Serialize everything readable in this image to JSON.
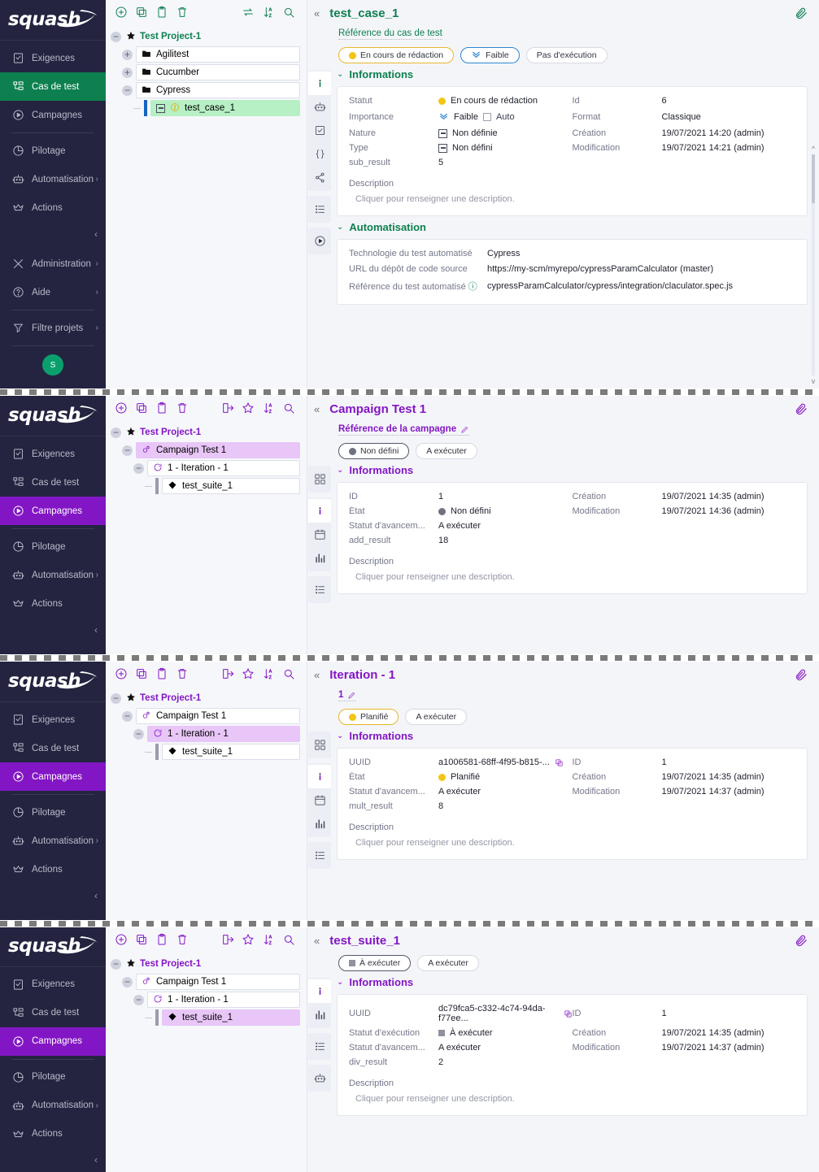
{
  "brand": {
    "logo_text": "squash",
    "avatar_initial": "S"
  },
  "sidebar": {
    "items": [
      {
        "label": "Exigences",
        "icon": "requirements-icon"
      },
      {
        "label": "Cas de test",
        "icon": "test-case-icon"
      },
      {
        "label": "Campagnes",
        "icon": "campaign-icon"
      },
      {
        "label": "Pilotage",
        "icon": "dashboard-icon"
      },
      {
        "label": "Automatisation",
        "icon": "robot-icon"
      },
      {
        "label": "Actions",
        "icon": "crown-icon"
      },
      {
        "label": "Administration",
        "icon": "tools-icon"
      },
      {
        "label": "Aide",
        "icon": "help-icon"
      },
      {
        "label": "Filtre projets",
        "icon": "filter-icon"
      }
    ]
  },
  "panels": [
    {
      "accent": "#0e8050",
      "active_nav": "Cas de test",
      "toolbar": [
        "add-icon",
        "copy-icon",
        "paste-icon",
        "delete-icon",
        "transfer-icon",
        "sort-icon",
        "search-icon"
      ],
      "tree": {
        "root": "Test Project-1",
        "nodes": [
          {
            "label": "Agilitest",
            "icon": "folder-icon",
            "depth": 1,
            "selected": false
          },
          {
            "label": "Cucumber",
            "icon": "folder-icon",
            "depth": 1,
            "selected": false
          },
          {
            "label": "Cypress",
            "icon": "folder-icon",
            "depth": 1,
            "selected": false
          },
          {
            "label": "test_case_1",
            "icon": "test-case-icon",
            "depth": 2,
            "selected": true
          }
        ]
      },
      "title": "test_case_1",
      "reference": "Référence du cas de test",
      "pills": [
        {
          "label": "En cours de rédaction",
          "style": "yellow",
          "marker": "dot-yellow"
        },
        {
          "label": "Faible",
          "style": "blue",
          "marker": "chevrons-down"
        },
        {
          "label": "Pas d'exécution",
          "style": "plain",
          "marker": "none"
        }
      ],
      "rail": [
        "info-icon",
        "robot-icon",
        "checkbox-icon",
        "braces-icon",
        "share-icon",
        "list-icon",
        "play-icon"
      ],
      "sections": [
        {
          "title": "Informations",
          "rows_left": [
            {
              "k": "Statut",
              "v": "En cours de rédaction",
              "marker": "dot-yellow"
            },
            {
              "k": "Importance",
              "v": "Faible",
              "marker": "chevrons-down",
              "extra": "Auto",
              "extra_type": "checkbox"
            },
            {
              "k": "Nature",
              "v": "Non définie",
              "marker": "square-minus"
            },
            {
              "k": "Type",
              "v": "Non défini",
              "marker": "square-minus"
            },
            {
              "k": "sub_result",
              "v": "5",
              "marker": "none"
            }
          ],
          "rows_right": [
            {
              "k": "Id",
              "v": "6"
            },
            {
              "k": "Format",
              "v": "Classique"
            },
            {
              "k": "Création",
              "v": "19/07/2021 14:20 (admin)"
            },
            {
              "k": "Modification",
              "v": "19/07/2021 14:21 (admin)"
            }
          ],
          "description_label": "Description",
          "description_value": "Cliquer pour renseigner une description."
        },
        {
          "title": "Automatisation",
          "auto_rows": [
            {
              "k": "Technologie du test automatisé",
              "v": "Cypress"
            },
            {
              "k": "URL du dépôt de code source",
              "v": "https://my-scm/myrepo/cypressParamCalculator (master)"
            },
            {
              "k": "Référence du test automatisé",
              "v": "cypressParamCalculator/cypress/integration/claculator.spec.js",
              "help": true
            }
          ]
        }
      ]
    },
    {
      "accent": "#8316c4",
      "active_nav": "Campagnes",
      "toolbar": [
        "add-icon",
        "copy-icon",
        "paste-icon",
        "delete-icon",
        "export-icon",
        "star-icon",
        "sort-icon",
        "search-icon"
      ],
      "tree": {
        "root": "Test Project-1",
        "nodes": [
          {
            "label": "Campaign Test 1",
            "icon": "campaign-node-icon",
            "depth": 1,
            "selected": true
          },
          {
            "label": "1 - Iteration - 1",
            "icon": "iteration-icon",
            "depth": 2,
            "selected": false
          },
          {
            "label": "test_suite_1",
            "icon": "suite-icon",
            "depth": 3,
            "selected": false
          }
        ]
      },
      "title": "Campaign Test 1",
      "reference": "Référence de la campagne",
      "pills": [
        {
          "label": "Non défini",
          "style": "dark",
          "marker": "dot-gray"
        },
        {
          "label": "A exécuter",
          "style": "plain",
          "marker": "none"
        }
      ],
      "rail": [
        "grid-icon",
        "info-icon",
        "calendar-icon",
        "chart-icon",
        "list-icon"
      ],
      "sections": [
        {
          "title": "Informations",
          "rows_left": [
            {
              "k": "ID",
              "v": "1",
              "marker": "none"
            },
            {
              "k": "État",
              "v": "Non défini",
              "marker": "dot-gray"
            },
            {
              "k": "Statut d'avancem...",
              "v": "A exécuter",
              "marker": "none"
            },
            {
              "k": "add_result",
              "v": "18",
              "marker": "none"
            }
          ],
          "rows_right": [
            {
              "k": "Création",
              "v": "19/07/2021 14:35 (admin)"
            },
            {
              "k": "Modification",
              "v": "19/07/2021 14:36 (admin)"
            }
          ],
          "description_label": "Description",
          "description_value": "Cliquer pour renseigner une description."
        }
      ]
    },
    {
      "accent": "#8316c4",
      "active_nav": "Campagnes",
      "toolbar": [
        "add-icon",
        "copy-icon",
        "paste-icon",
        "delete-icon",
        "export-icon",
        "star-icon",
        "sort-icon",
        "search-icon"
      ],
      "tree": {
        "root": "Test Project-1",
        "nodes": [
          {
            "label": "Campaign Test 1",
            "icon": "campaign-node-icon",
            "depth": 1,
            "selected": false
          },
          {
            "label": "1 - Iteration - 1",
            "icon": "iteration-icon",
            "depth": 2,
            "selected": true
          },
          {
            "label": "test_suite_1",
            "icon": "suite-icon",
            "depth": 3,
            "selected": false
          }
        ]
      },
      "title": "Iteration - 1",
      "reference": "1",
      "pills": [
        {
          "label": "Planifié",
          "style": "yellow",
          "marker": "dot-yellow"
        },
        {
          "label": "A exécuter",
          "style": "plain",
          "marker": "none"
        }
      ],
      "rail": [
        "grid-icon",
        "info-icon",
        "calendar-icon",
        "chart-icon",
        "list-icon"
      ],
      "sections": [
        {
          "title": "Informations",
          "rows_left": [
            {
              "k": "UUID",
              "v": "a1006581-68ff-4f95-b815-...",
              "marker": "none",
              "copy": true
            },
            {
              "k": "État",
              "v": "Planifié",
              "marker": "dot-yellow"
            },
            {
              "k": "Statut d'avancem...",
              "v": "A exécuter",
              "marker": "none"
            },
            {
              "k": "mult_result",
              "v": "8",
              "marker": "none"
            }
          ],
          "rows_right": [
            {
              "k": "ID",
              "v": "1"
            },
            {
              "k": "Création",
              "v": "19/07/2021 14:35 (admin)"
            },
            {
              "k": "Modification",
              "v": "19/07/2021 14:37 (admin)"
            }
          ],
          "description_label": "Description",
          "description_value": "Cliquer pour renseigner une description."
        }
      ]
    },
    {
      "accent": "#8316c4",
      "active_nav": "Campagnes",
      "toolbar": [
        "add-icon",
        "copy-icon",
        "paste-icon",
        "delete-icon",
        "export-icon",
        "star-icon",
        "sort-icon",
        "search-icon"
      ],
      "tree": {
        "root": "Test Project-1",
        "nodes": [
          {
            "label": "Campaign Test 1",
            "icon": "campaign-node-icon",
            "depth": 1,
            "selected": false
          },
          {
            "label": "1 - Iteration - 1",
            "icon": "iteration-icon",
            "depth": 2,
            "selected": false
          },
          {
            "label": "test_suite_1",
            "icon": "suite-icon",
            "depth": 3,
            "selected": true
          }
        ]
      },
      "title": "test_suite_1",
      "reference": "",
      "pills": [
        {
          "label": "À exécuter",
          "style": "dark",
          "marker": "square-gray"
        },
        {
          "label": "A exécuter",
          "style": "plain",
          "marker": "none"
        }
      ],
      "rail": [
        "info-icon",
        "chart-icon",
        "list-icon",
        "robot-icon"
      ],
      "sections": [
        {
          "title": "Informations",
          "rows_left": [
            {
              "k": "UUID",
              "v": "dc79fca5-c332-4c74-94da-f77ee...",
              "marker": "none",
              "copy": true
            },
            {
              "k": "Statut d'exécution",
              "v": "À exécuter",
              "marker": "square-gray"
            },
            {
              "k": "Statut d'avancem...",
              "v": "A exécuter",
              "marker": "none"
            },
            {
              "k": "div_result",
              "v": "2",
              "marker": "none"
            }
          ],
          "rows_right": [
            {
              "k": "ID",
              "v": "1"
            },
            {
              "k": "Création",
              "v": "19/07/2021 14:35 (admin)"
            },
            {
              "k": "Modification",
              "v": "19/07/2021 14:37 (admin)"
            }
          ],
          "description_label": "Description",
          "description_value": "Cliquer pour renseigner une description."
        }
      ]
    }
  ]
}
